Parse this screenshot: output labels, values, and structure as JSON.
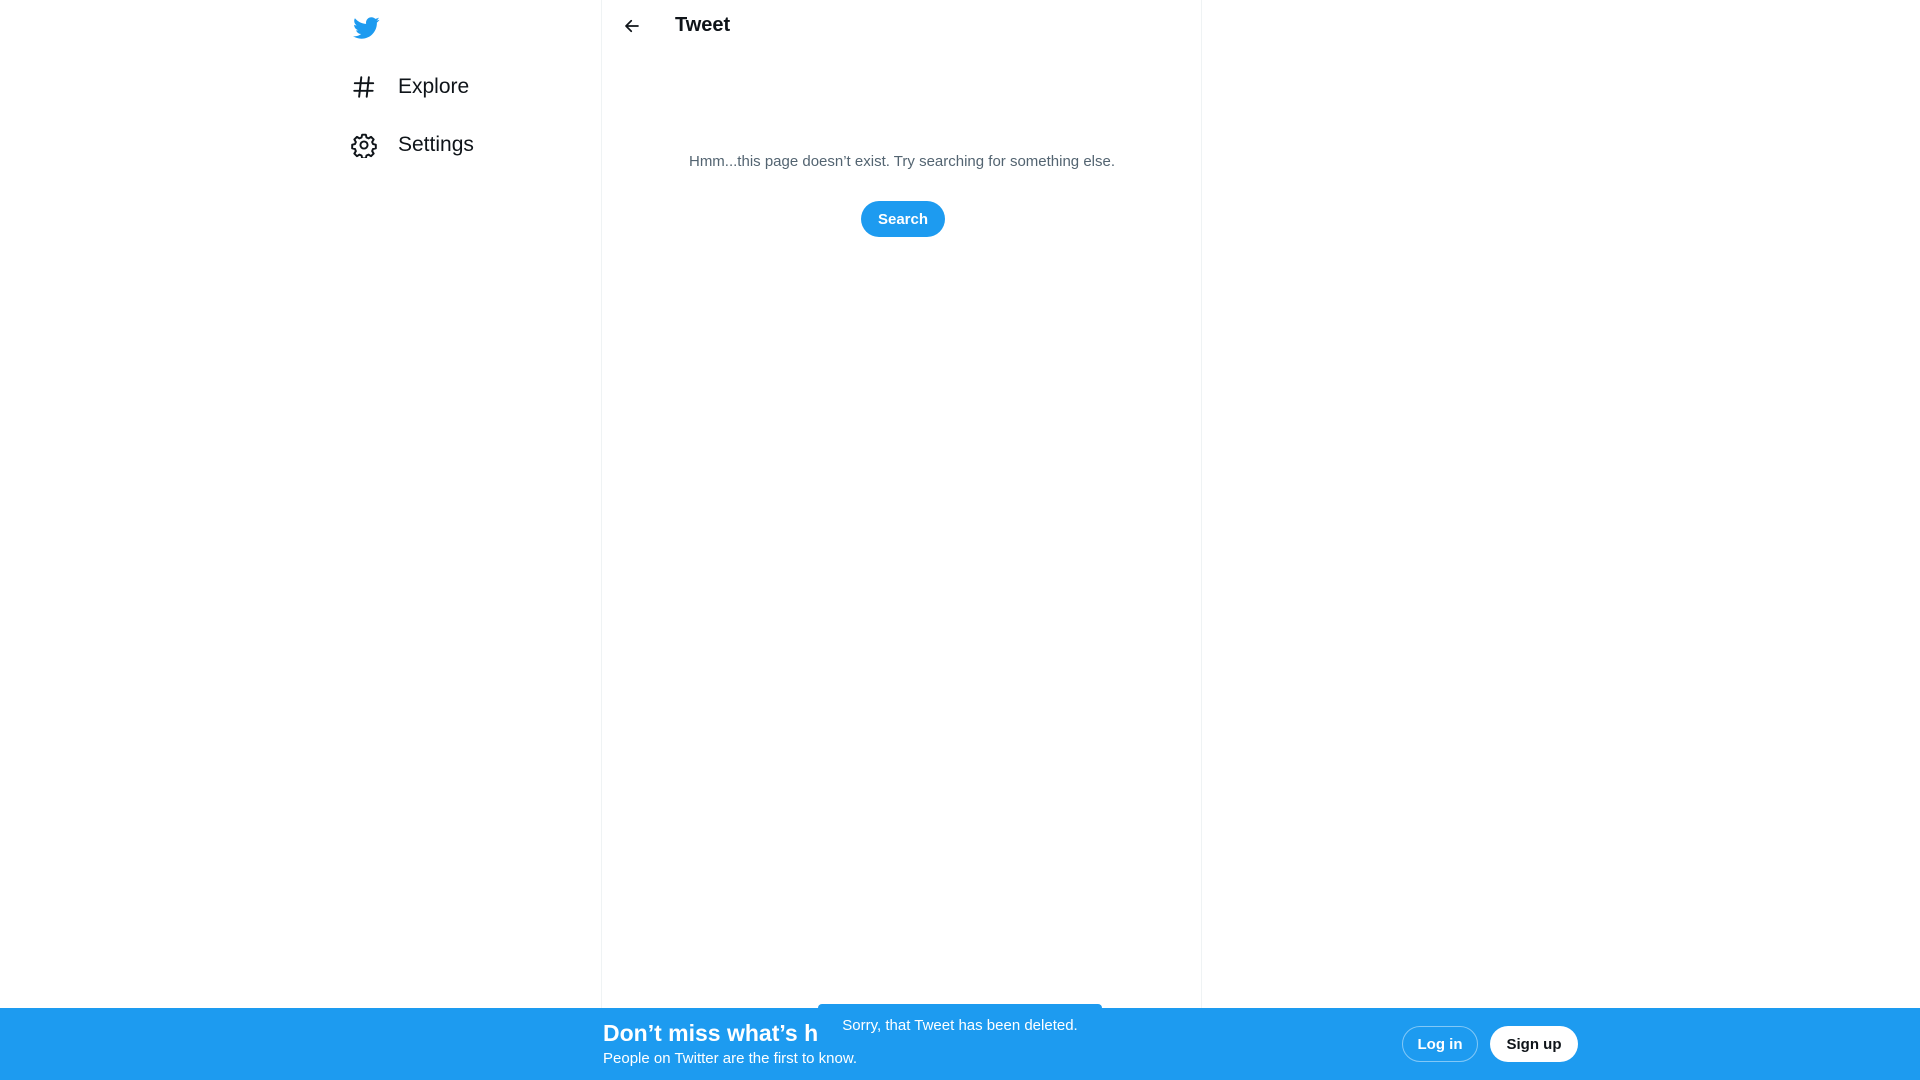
{
  "colors": {
    "brand": "#1d9bf0",
    "text_primary": "#0f1419",
    "text_secondary": "#536471",
    "border": "#eff3f4"
  },
  "sidebar": {
    "logo_icon": "twitter-bird-icon",
    "items": [
      {
        "icon": "hashtag-icon",
        "label": "Explore"
      },
      {
        "icon": "gear-icon",
        "label": "Settings"
      }
    ]
  },
  "header": {
    "back_icon": "arrow-left-icon",
    "title": "Tweet"
  },
  "main": {
    "message": "Hmm...this page doesn’t exist. Try searching for something else.",
    "search_label": "Search"
  },
  "banner": {
    "title": "Don’t miss what’s h",
    "subtitle": "People on Twitter are the first to know.",
    "login_label": "Log in",
    "signup_label": "Sign up"
  },
  "toast": {
    "message": "Sorry, that Tweet has been deleted."
  }
}
